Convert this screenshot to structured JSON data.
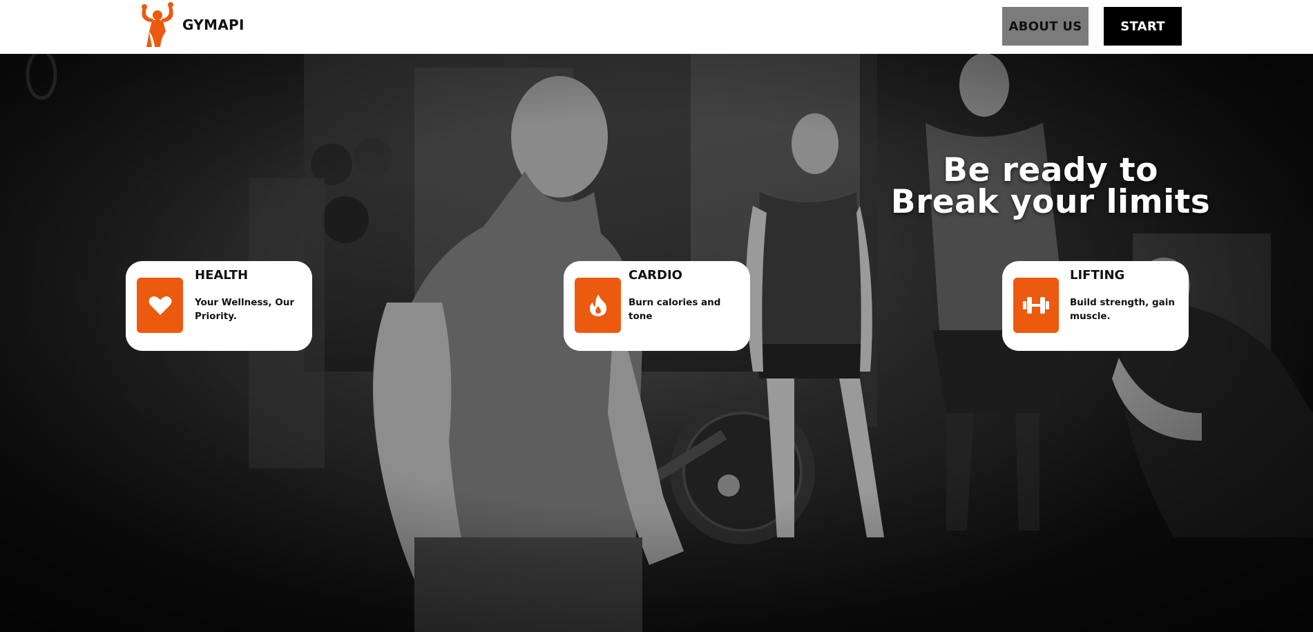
{
  "header": {
    "brand": "GYMAPI",
    "logo_icon": "flexing-bodybuilder-icon",
    "nav": [
      {
        "label": "ABOUT US"
      },
      {
        "label": "START"
      }
    ]
  },
  "hero": {
    "headline_line1": "Be ready to",
    "headline_line2": "Break your limits",
    "background": "black-and-white gym photo of athletes lifting"
  },
  "features": [
    {
      "icon": "heart-icon",
      "title": "HEALTH",
      "description": "Your Wellness, Our Priority."
    },
    {
      "icon": "flame-icon",
      "title": "CARDIO",
      "description": "Burn calories and tone"
    },
    {
      "icon": "dumbbell-icon",
      "title": "LIFTING",
      "description": "Build strength, gain muscle."
    }
  ],
  "colors": {
    "accent": "#ec5a0f",
    "header_bg": "#ffffff",
    "about_button_bg": "#7b7b7b",
    "start_button_bg": "#000000",
    "card_bg": "#ffffff"
  }
}
